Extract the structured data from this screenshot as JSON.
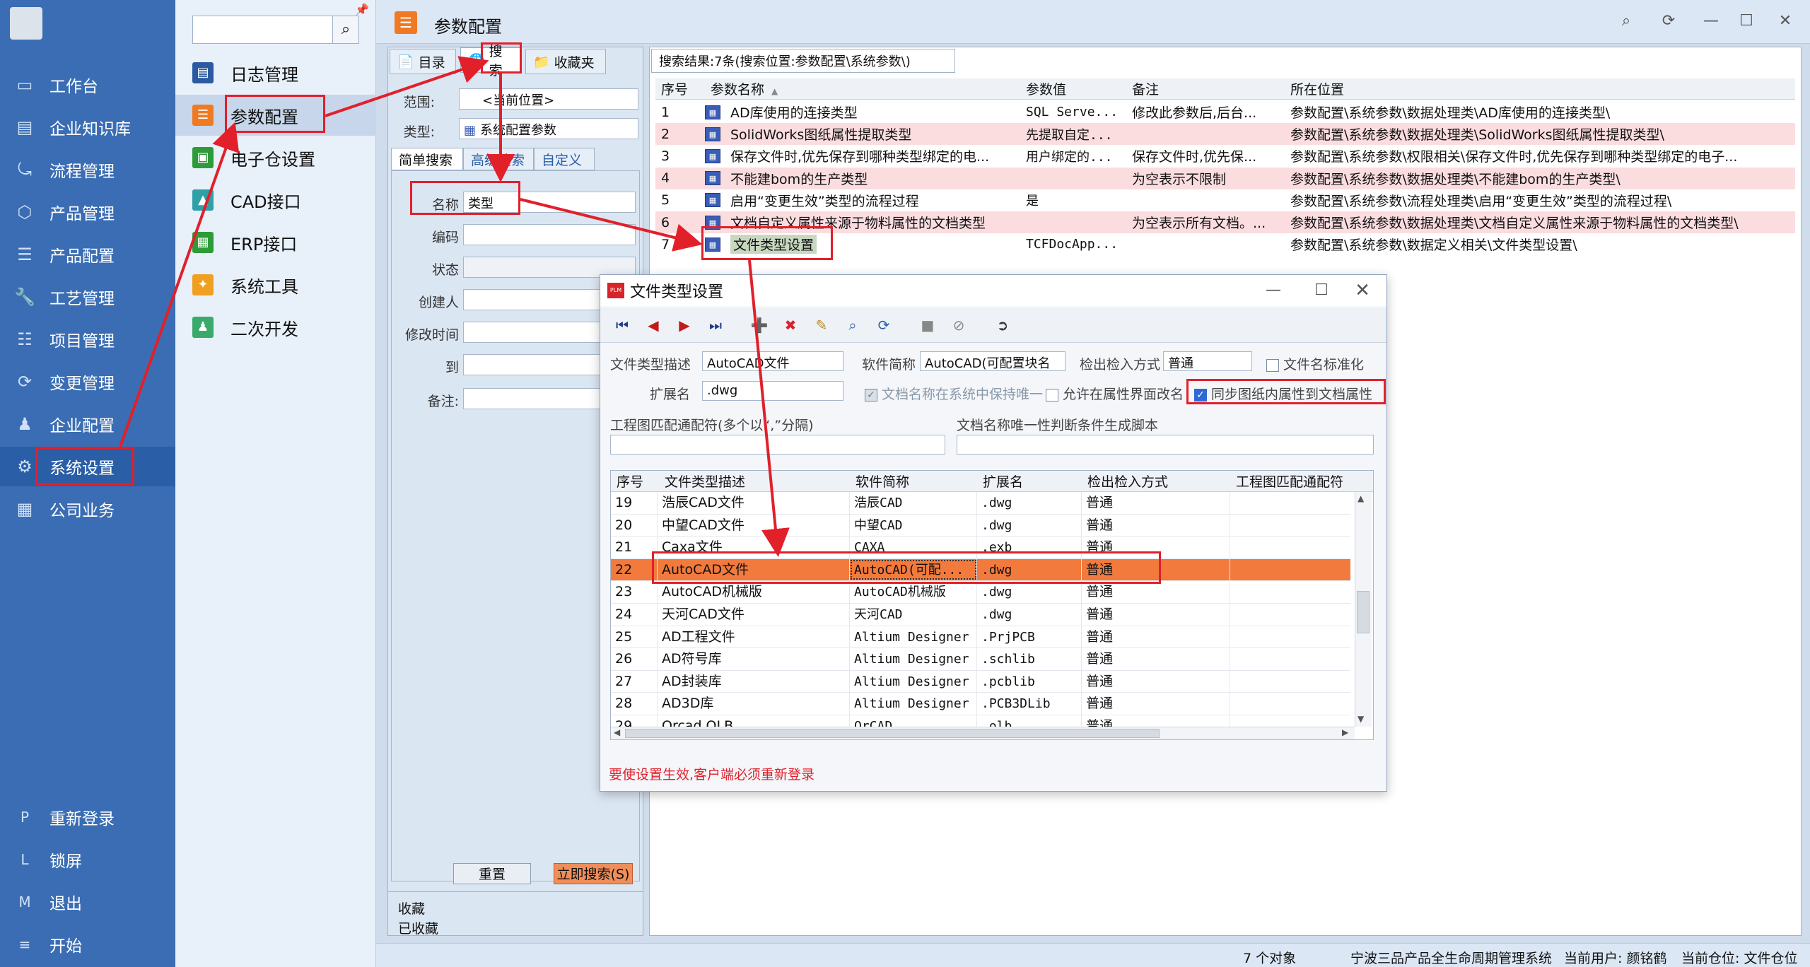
{
  "nav": {
    "items": [
      {
        "label": "工作台",
        "icon": "monitor-icon"
      },
      {
        "label": "企业知识库",
        "icon": "book-icon"
      },
      {
        "label": "流程管理",
        "icon": "flow-icon"
      },
      {
        "label": "产品管理",
        "icon": "cube-icon"
      },
      {
        "label": "产品配置",
        "icon": "sliders-icon"
      },
      {
        "label": "工艺管理",
        "icon": "wrench-icon"
      },
      {
        "label": "项目管理",
        "icon": "chart-icon"
      },
      {
        "label": "变更管理",
        "icon": "refresh-icon"
      },
      {
        "label": "企业配置",
        "icon": "users-icon"
      },
      {
        "label": "系统设置",
        "icon": "gear-icon"
      },
      {
        "label": "公司业务",
        "icon": "grid-icon"
      }
    ],
    "bottom": [
      {
        "key": "P",
        "label": "重新登录"
      },
      {
        "key": "L",
        "label": "锁屏"
      },
      {
        "key": "M",
        "label": "退出"
      },
      {
        "key": "≡",
        "label": "开始"
      }
    ]
  },
  "submenu": {
    "items": [
      {
        "label": "日志管理",
        "color": "#2c5aa0"
      },
      {
        "label": "参数配置",
        "color": "#f07a23"
      },
      {
        "label": "电子仓设置",
        "color": "#2f9a3a"
      },
      {
        "label": "CAD接口",
        "color": "#2fa0a8"
      },
      {
        "label": "ERP接口",
        "color": "#2f9a3a"
      },
      {
        "label": "系统工具",
        "color": "#f0a020"
      },
      {
        "label": "二次开发",
        "color": "#3aaa6a"
      }
    ]
  },
  "header": {
    "title": "参数配置"
  },
  "searchpanel": {
    "tabs": [
      "目录",
      "搜索",
      "收藏夹"
    ],
    "scope_label": "范围:",
    "scope_value": "<当前位置>",
    "type_label": "类型:",
    "type_value": "系统配置参数",
    "subtabs": [
      "简单搜索",
      "高级搜索",
      "自定义"
    ],
    "fields": [
      {
        "label": "名称",
        "value": "类型"
      },
      {
        "label": "编码",
        "value": ""
      },
      {
        "label": "状态",
        "value": ""
      },
      {
        "label": "创建人",
        "value": ""
      },
      {
        "label": "修改时间",
        "value": ""
      },
      {
        "label": "到",
        "value": ""
      },
      {
        "label": "备注:",
        "value": ""
      }
    ],
    "reset_label": "重置",
    "search_label": "立即搜索(S)",
    "fav_label": "收藏",
    "faved_label": "已收藏"
  },
  "results": {
    "tab_label": "搜索结果:7条(搜索位置:参数配置\\系统参数\\)",
    "columns": [
      "序号",
      "参数名称",
      "参数值",
      "备注",
      "所在位置"
    ],
    "rows": [
      {
        "no": "1",
        "name": "AD库使用的连接类型",
        "value": "SQL Serve...",
        "note": "修改此参数后,后台...",
        "loc": "参数配置\\系统参数\\数据处理类\\AD库使用的连接类型\\"
      },
      {
        "no": "2",
        "name": "SolidWorks图纸属性提取类型",
        "value": "先提取自定...",
        "note": "",
        "loc": "参数配置\\系统参数\\数据处理类\\SolidWorks图纸属性提取类型\\"
      },
      {
        "no": "3",
        "name": "保存文件时,优先保存到哪种类型绑定的电...",
        "value": "用户绑定的...",
        "note": "保存文件时,优先保...",
        "loc": "参数配置\\系统参数\\权限相关\\保存文件时,优先保存到哪种类型绑定的电子..."
      },
      {
        "no": "4",
        "name": "不能建bom的生产类型",
        "value": "",
        "note": "为空表示不限制",
        "loc": "参数配置\\系统参数\\数据处理类\\不能建bom的生产类型\\"
      },
      {
        "no": "5",
        "name": "启用“变更生效”类型的流程过程",
        "value": "是",
        "note": "",
        "loc": "参数配置\\系统参数\\流程处理类\\启用“变更生效”类型的流程过程\\"
      },
      {
        "no": "6",
        "name": "文档自定义属性来源于物料属性的文档类型",
        "value": "",
        "note": "为空表示所有文档。...",
        "loc": "参数配置\\系统参数\\数据处理类\\文档自定义属性来源于物料属性的文档类型\\"
      },
      {
        "no": "7",
        "name": "文件类型设置",
        "value": "TCFDocApp...",
        "note": "",
        "loc": "参数配置\\系统参数\\数据定义相关\\文件类型设置\\"
      }
    ]
  },
  "dialog": {
    "title": "文件类型设置",
    "app_icon": "PLM",
    "desc_label": "文件类型描述",
    "desc_value": "AutoCAD文件",
    "soft_label": "软件简称",
    "soft_value": "AutoCAD(可配置块名",
    "checkio_label": "检出检入方式",
    "checkio_value": "普通",
    "standardize_label": "文件名标准化",
    "ext_label": "扩展名",
    "ext_value": ".dwg",
    "unique_label": "文档名称在系统中保持唯一",
    "allow_rename_label": "允许在属性界面改名",
    "sync_label": "同步图纸内属性到文档属性",
    "match_label": "工程图匹配通配符(多个以“,”分隔)",
    "script_label": "文档名称唯一性判断条件生成脚本",
    "columns": [
      "序号",
      "文件类型描述",
      "软件简称",
      "扩展名",
      "检出检入方式",
      "工程图匹配通配符"
    ],
    "rows": [
      {
        "no": "19",
        "desc": "浩辰CAD文件",
        "soft": "浩辰CAD",
        "ext": ".dwg",
        "mode": "普通"
      },
      {
        "no": "20",
        "desc": "中望CAD文件",
        "soft": "中望CAD",
        "ext": ".dwg",
        "mode": "普通"
      },
      {
        "no": "21",
        "desc": "Caxa文件",
        "soft": "CAXA",
        "ext": ".exb",
        "mode": "普通"
      },
      {
        "no": "22",
        "desc": "AutoCAD文件",
        "soft": "AutoCAD(可配...",
        "ext": ".dwg",
        "mode": "普通"
      },
      {
        "no": "23",
        "desc": "AutoCAD机械版",
        "soft": "AutoCAD机械版",
        "ext": ".dwg",
        "mode": "普通"
      },
      {
        "no": "24",
        "desc": "天河CAD文件",
        "soft": "天河CAD",
        "ext": ".dwg",
        "mode": "普通"
      },
      {
        "no": "25",
        "desc": "AD工程文件",
        "soft": "Altium Designer",
        "ext": ".PrjPCB",
        "mode": "普通"
      },
      {
        "no": "26",
        "desc": "AD符号库",
        "soft": "Altium Designer",
        "ext": ".schlib",
        "mode": "普通"
      },
      {
        "no": "27",
        "desc": "AD封装库",
        "soft": "Altium Designer",
        "ext": ".pcblib",
        "mode": "普通"
      },
      {
        "no": "28",
        "desc": "AD3D库",
        "soft": "Altium Designer",
        "ext": ".PCB3DLib",
        "mode": "普通"
      },
      {
        "no": "29",
        "desc": "Orcad OLB",
        "soft": "OrCAD",
        "ext": ".olb",
        "mode": "普通"
      }
    ],
    "selected_index": 3,
    "warning": "要使设置生效,客户端必须重新登录"
  },
  "status": {
    "count": "7 个对象",
    "system": "宁波三品产品全生命周期管理系统",
    "user": "当前用户: 颜铭鹤",
    "warehouse": "当前仓位: 文件仓位"
  },
  "colors": {
    "nav_bg": "#3a6db3",
    "highlight_red": "#e1202a",
    "selected_row": "#f17a3c",
    "warning_text": "#e1202a"
  }
}
